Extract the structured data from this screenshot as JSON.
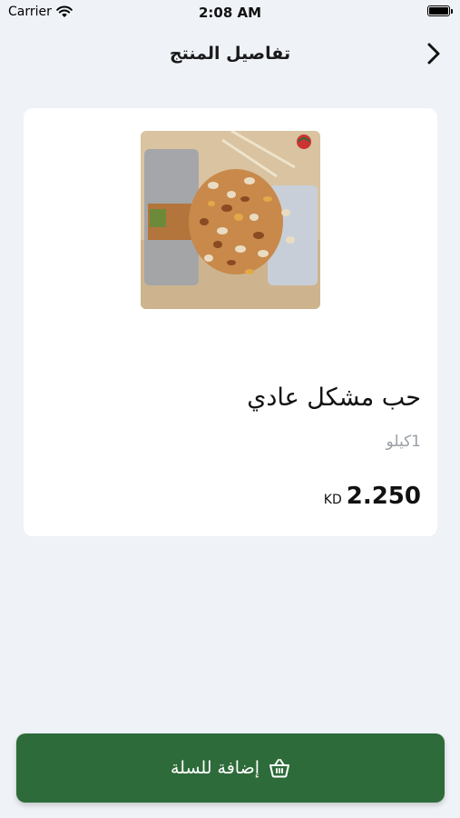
{
  "status_bar": {
    "carrier": "Carrier",
    "time": "2:08 AM"
  },
  "header": {
    "title": "تفاصيل المنتج"
  },
  "product": {
    "name": "حب مشكل عادي",
    "unit": "1كيلو",
    "price_value": "2.250",
    "currency": "KD"
  },
  "cart_button": {
    "label": "إضافة للسلة"
  },
  "colors": {
    "primary": "#2e6b3a",
    "background": "#eff2f6",
    "card": "#ffffff",
    "muted_text": "#9aa0a8"
  },
  "icons": {
    "back": "chevron-right-icon",
    "basket": "basket-icon",
    "wifi": "wifi-icon",
    "battery": "battery-icon"
  }
}
